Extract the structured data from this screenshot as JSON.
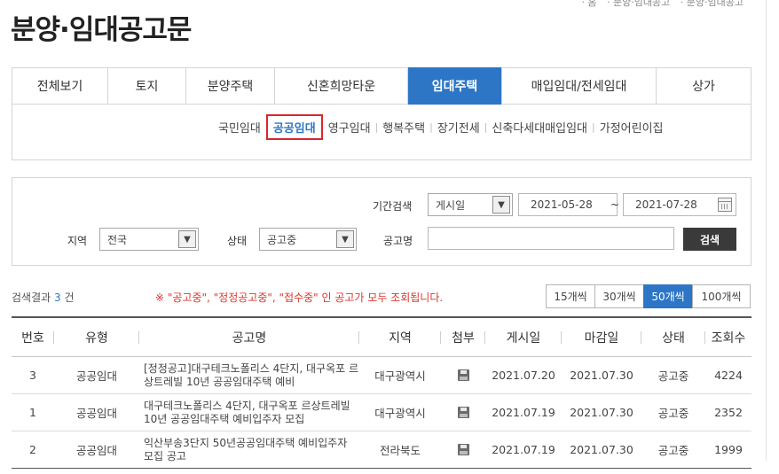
{
  "header": {
    "title": "분양·임대공고문",
    "top_links": [
      "· 홈",
      "· 분양·임대공고",
      "· 분양·임대공고"
    ]
  },
  "tabs": [
    {
      "label": "전체보기",
      "active": false
    },
    {
      "label": "토지",
      "active": false
    },
    {
      "label": "분양주택",
      "active": false
    },
    {
      "label": "신혼희망타운",
      "active": false
    },
    {
      "label": "임대주택",
      "active": true
    },
    {
      "label": "매입임대/전세임대",
      "active": false
    },
    {
      "label": "상가",
      "active": false
    }
  ],
  "subtabs": [
    {
      "label": "국민임대",
      "active": false
    },
    {
      "label": "공공임대",
      "active": true
    },
    {
      "label": "영구임대",
      "active": false
    },
    {
      "label": "행복주택",
      "active": false
    },
    {
      "label": "장기전세",
      "active": false
    },
    {
      "label": "신축다세대매입임대",
      "active": false
    },
    {
      "label": "가정어린이집",
      "active": false
    }
  ],
  "search": {
    "period_label": "기간검색",
    "period_type": "게시일",
    "date_from": "2021-05-28",
    "date_sep": "~",
    "date_to": "2021-07-28",
    "region_label": "지역",
    "region_value": "전국",
    "status_label": "상태",
    "status_value": "공고중",
    "name_label": "공고명",
    "name_value": "",
    "search_button": "검색"
  },
  "results": {
    "count_prefix": "검색결과",
    "count": "3",
    "count_suffix": "건",
    "notice": "※ \"공고중\", \"정정공고중\", \"접수중\" 인 공고가 모두 조회됩니다.",
    "page_sizes": [
      {
        "label": "15개씩",
        "active": false
      },
      {
        "label": "30개씩",
        "active": false
      },
      {
        "label": "50개씩",
        "active": true
      },
      {
        "label": "100개씩",
        "active": false
      }
    ]
  },
  "table": {
    "headers": [
      "번호",
      "유형",
      "공고명",
      "지역",
      "첨부",
      "게시일",
      "마감일",
      "상태",
      "조회수"
    ],
    "rows": [
      {
        "no": "3",
        "type": "공공임대",
        "name": "[정정공고]대구테크노폴리스 4단지, 대구옥포 르상트레빌 10년 공공임대주택 예비",
        "region": "대구광역시",
        "attach": "floppy-disk-icon",
        "posted": "2021.07.20",
        "deadline": "2021.07.30",
        "status": "공고중",
        "views": "4224"
      },
      {
        "no": "1",
        "type": "공공임대",
        "name": "대구테크노폴리스 4단지, 대구옥포 르상트레빌 10년 공공임대주택 예비입주자 모집",
        "region": "대구광역시",
        "attach": "floppy-disk-icon",
        "posted": "2021.07.19",
        "deadline": "2021.07.30",
        "status": "공고중",
        "views": "2352"
      },
      {
        "no": "2",
        "type": "공공임대",
        "name": "익산부송3단지 50년공공임대주택 예비입주자 모집 공고",
        "region": "전라북도",
        "attach": "floppy-disk-icon",
        "posted": "2021.07.19",
        "deadline": "2021.07.30",
        "status": "공고중",
        "views": "1999"
      }
    ]
  }
}
